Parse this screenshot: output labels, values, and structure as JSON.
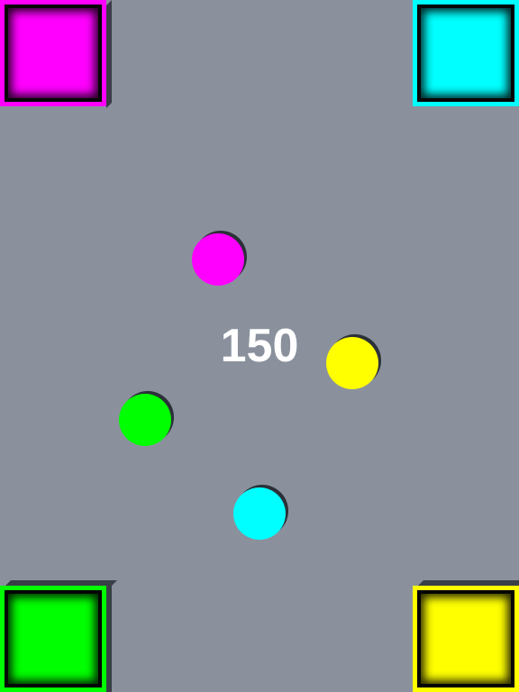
{
  "score": "150",
  "colors": {
    "magenta": "#ff00ff",
    "cyan": "#00ffff",
    "green": "#00ff00",
    "yellow": "#ffff00",
    "background": "#8a919d"
  },
  "bins": [
    {
      "name": "magenta",
      "position": "top-left"
    },
    {
      "name": "cyan",
      "position": "top-right"
    },
    {
      "name": "green",
      "position": "bottom-left"
    },
    {
      "name": "yellow",
      "position": "bottom-right"
    }
  ],
  "balls": [
    "magenta",
    "yellow",
    "green",
    "cyan"
  ]
}
